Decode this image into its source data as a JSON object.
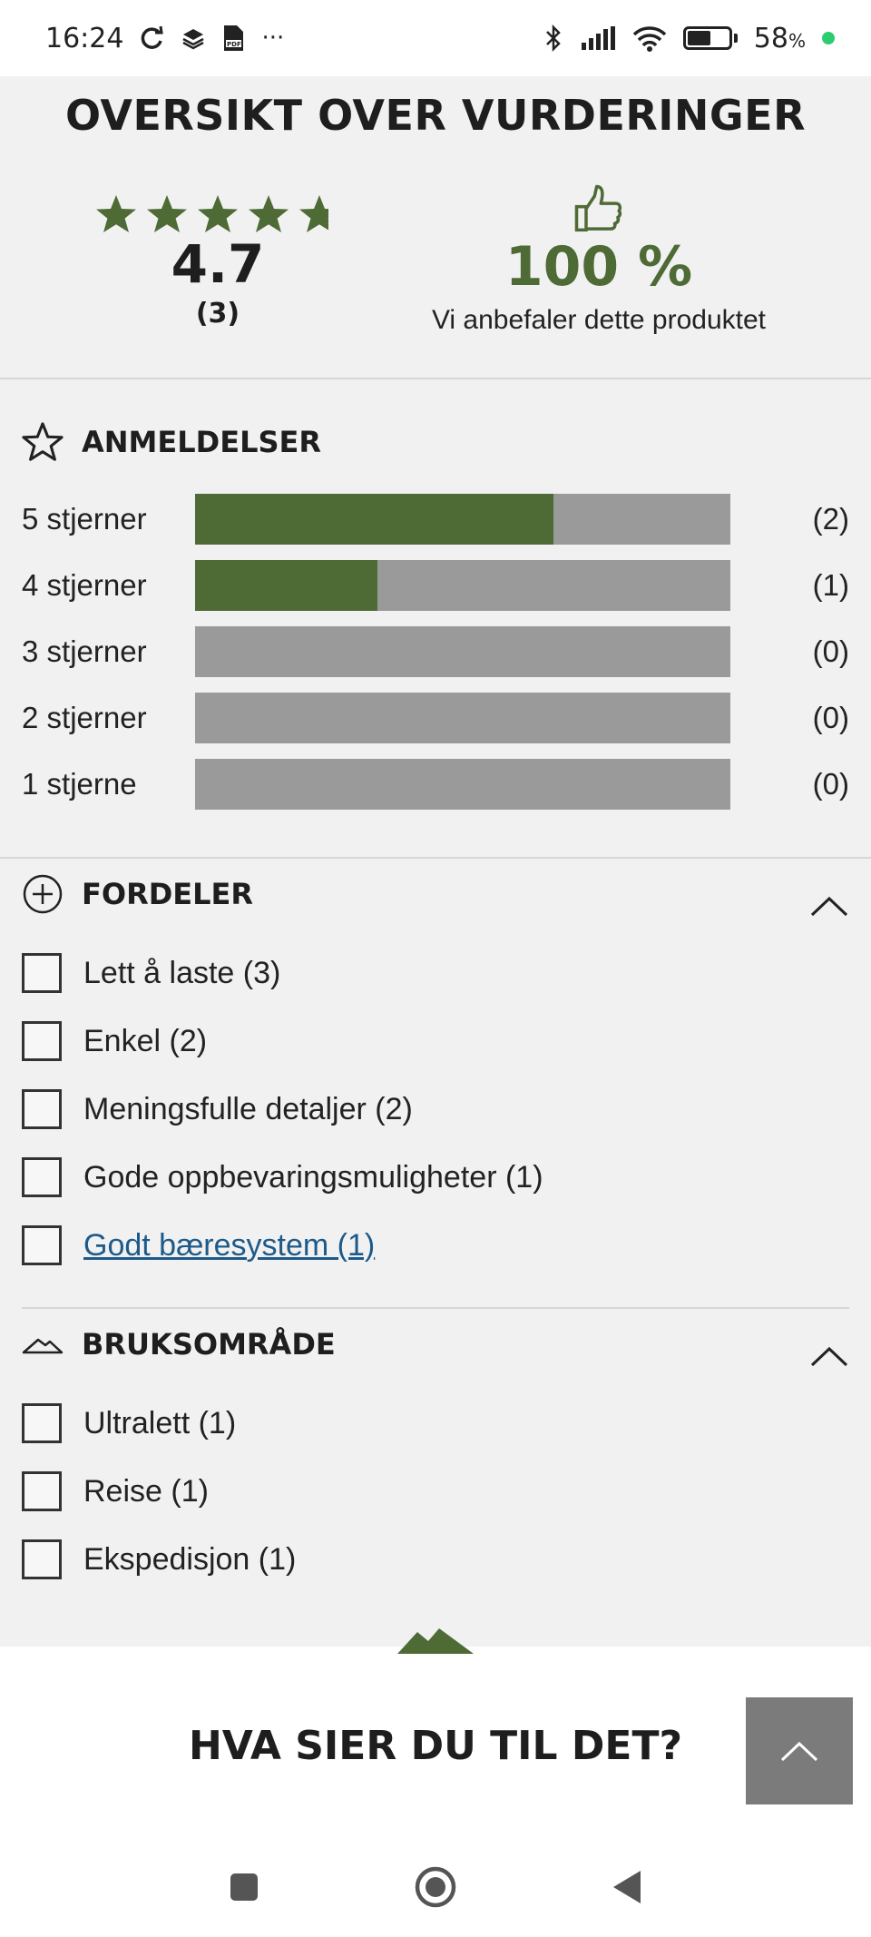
{
  "status_bar": {
    "time": "16:24",
    "icons_left": [
      "sync-icon",
      "layers-icon",
      "pdf-icon",
      "more-icon"
    ],
    "more": "···",
    "battery_percent": "58",
    "percent_sign": "%"
  },
  "reviews_overview": {
    "title": "OVERSIKT OVER VURDERINGER",
    "average_rating": "4.7",
    "rating_value": 4.7,
    "review_count": "(3)",
    "recommend_percent": "100 %",
    "recommend_text": "Vi anbefaler dette produktet"
  },
  "ratings": {
    "heading": "ANMELDELSER",
    "rows": [
      {
        "label": "5 stjerner",
        "count": "(2)",
        "share": 0.67
      },
      {
        "label": "4 stjerner",
        "count": "(1)",
        "share": 0.34
      },
      {
        "label": "3 stjerner",
        "count": "(0)",
        "share": 0
      },
      {
        "label": "2 stjerner",
        "count": "(0)",
        "share": 0
      },
      {
        "label": "1 stjerne",
        "count": "(0)",
        "share": 0
      }
    ]
  },
  "pros": {
    "heading": "FORDELER",
    "items": [
      {
        "label": "Lett å laste (3)",
        "checked": false
      },
      {
        "label": "Enkel (2)",
        "checked": false
      },
      {
        "label": "Meningsfulle detaljer (2)",
        "checked": false
      },
      {
        "label": "Gode oppbevaringsmuligheter (1)",
        "checked": false
      },
      {
        "label": "Godt bæresystem (1)",
        "checked": false
      }
    ]
  },
  "usage": {
    "heading": "BRUKSOMRÅDE",
    "items": [
      {
        "label": "Ultralett (1)",
        "checked": false
      },
      {
        "label": "Reise (1)",
        "checked": false
      },
      {
        "label": "Ekspedisjon (1)",
        "checked": false
      }
    ]
  },
  "footer": {
    "title": "HVA SIER DU TIL DET?"
  },
  "colors": {
    "accent_green": "#4e6b36",
    "bar_gray": "#9a9a9a",
    "link_blue": "#1d5a8a"
  }
}
